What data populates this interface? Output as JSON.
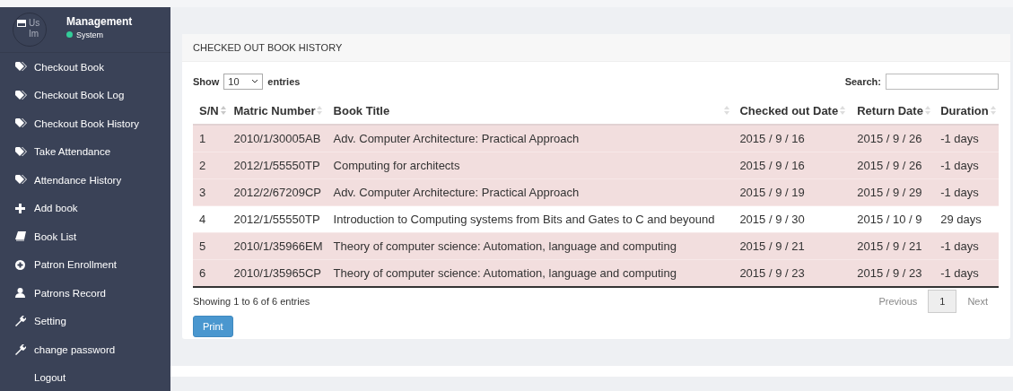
{
  "sidebar": {
    "avatar_text": [
      "Us",
      "Im"
    ],
    "user_name": "Management",
    "status": "System",
    "items": [
      {
        "label": "Checkout Book",
        "kind": "tag"
      },
      {
        "label": "Checkout Book Log",
        "kind": "tag"
      },
      {
        "label": "Checkout Book History",
        "kind": "tag"
      },
      {
        "label": "Take Attendance",
        "kind": "tag"
      },
      {
        "label": "Attendance History",
        "kind": "tag"
      },
      {
        "label": "Add book",
        "kind": "plus"
      },
      {
        "label": "Book List",
        "kind": "book"
      },
      {
        "label": "Patron Enrollment",
        "kind": "enroll"
      },
      {
        "label": "Patrons Record",
        "kind": "user"
      },
      {
        "label": "Setting",
        "kind": "wrench"
      },
      {
        "label": "change password",
        "kind": "wrench"
      },
      {
        "label": "Logout",
        "kind": "plain"
      }
    ]
  },
  "panel": {
    "title": "CHECKED OUT BOOK HISTORY",
    "length": {
      "before": "Show",
      "value": "10",
      "after": "entries"
    },
    "search": {
      "label": "Search:"
    },
    "table": {
      "columns": [
        "S/N",
        "Matric Number",
        "Book Title",
        "Checked out Date",
        "Return Date",
        "Duration"
      ],
      "rows": [
        {
          "cells": [
            "1",
            "2010/1/30005AB",
            "Adv. Computer Architecture: Practical Approach",
            "2015 / 9 / 16",
            "2015 / 9 / 26",
            "-1 days"
          ],
          "overdue": true
        },
        {
          "cells": [
            "2",
            "2012/1/55550TP",
            "Computing for architects",
            "2015 / 9 / 16",
            "2015 / 9 / 26",
            "-1 days"
          ],
          "overdue": true
        },
        {
          "cells": [
            "3",
            "2012/2/67209CP",
            "Adv. Computer Architecture: Practical Approach",
            "2015 / 9 / 19",
            "2015 / 9 / 29",
            "-1 days"
          ],
          "overdue": true
        },
        {
          "cells": [
            "4",
            "2012/1/55550TP",
            "Introduction to Computing systems from Bits and Gates to C and beyound",
            "2015 / 9 / 30",
            "2015 / 10 / 9",
            "29 days"
          ],
          "overdue": false
        },
        {
          "cells": [
            "5",
            "2010/1/35966EM",
            "Theory of computer science: Automation, language and computing",
            "2015 / 9 / 21",
            "2015 / 9 / 21",
            "-1 days"
          ],
          "overdue": true
        },
        {
          "cells": [
            "6",
            "2010/1/35965CP",
            "Theory of computer science: Automation, language and computing",
            "2015 / 9 / 23",
            "2015 / 9 / 23",
            "-1 days"
          ],
          "overdue": true
        }
      ]
    },
    "info": "Showing 1 to 6 of 6 entries",
    "pagination": [
      {
        "label": "Previous",
        "kind": "prev",
        "selected": false
      },
      {
        "label": "1",
        "kind": "page",
        "selected": true
      },
      {
        "label": "Next",
        "kind": "next",
        "selected": false
      }
    ],
    "print_button": "Print"
  }
}
